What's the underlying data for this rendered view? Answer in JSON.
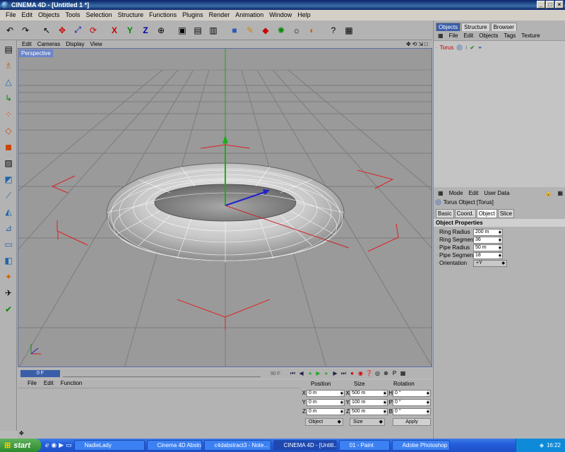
{
  "window": {
    "title": "CINEMA 4D - [Untitled 1 *]",
    "controls": [
      "_",
      "□",
      "×"
    ]
  },
  "menubar": [
    "File",
    "Edit",
    "Objects",
    "Tools",
    "Selection",
    "Structure",
    "Functions",
    "Plugins",
    "Render",
    "Animation",
    "Window",
    "Help"
  ],
  "viewport": {
    "menu": [
      "Edit",
      "Cameras",
      "Display",
      "View"
    ],
    "label": "Perspective"
  },
  "timeline": {
    "current_frame": "0 F",
    "end_frame": "90 F"
  },
  "material_menu": [
    "File",
    "Edit",
    "Function"
  ],
  "coords": {
    "headers": {
      "position": "Position",
      "size": "Size",
      "rotation": "Rotation"
    },
    "rows": [
      {
        "axis": "X",
        "pos": "0 m",
        "size_axis": "X",
        "size": "500 m",
        "rot_axis": "H",
        "rot": "0 °"
      },
      {
        "axis": "Y",
        "pos": "0 m",
        "size_axis": "Y",
        "size": "100 m",
        "rot_axis": "P",
        "rot": "0 °"
      },
      {
        "axis": "Z",
        "pos": "0 m",
        "size_axis": "Z",
        "size": "500 m",
        "rot_axis": "B",
        "rot": "0 °"
      }
    ],
    "mode_dropdown": "Object",
    "size_dropdown": "Size",
    "apply_label": "Apply"
  },
  "object_manager": {
    "tabs": [
      "Objects",
      "Structure",
      "Browser"
    ],
    "menu": [
      "File",
      "Edit",
      "Objects",
      "Tags",
      "Texture"
    ],
    "objects": [
      {
        "name": "Torus"
      }
    ]
  },
  "attributes": {
    "menu": [
      "Mode",
      "Edit",
      "User Data"
    ],
    "object_title": "Torus Object [Torus]",
    "tabs": [
      "Basic",
      "Coord.",
      "Object",
      "Slice"
    ],
    "active_tab": "Object",
    "section": "Object Properties",
    "properties": [
      {
        "label": "Ring Radius",
        "value": "200 m"
      },
      {
        "label": "Ring Segments",
        "value": "36"
      },
      {
        "label": "Pipe Radius",
        "value": "50 m"
      },
      {
        "label": "Pipe Segments",
        "value": "18"
      }
    ],
    "orientation": {
      "label": "Orientation",
      "value": "+Y"
    }
  },
  "taskbar": {
    "start": "start",
    "tasks": [
      "NadieLady",
      "Cinema 4D Abstract...",
      "c4dabstract3 - Note...",
      "CINEMA 4D - [Untitl...",
      "01 - Paint",
      "Adobe Photoshop"
    ],
    "active_task": 3,
    "clock": "16:22"
  }
}
